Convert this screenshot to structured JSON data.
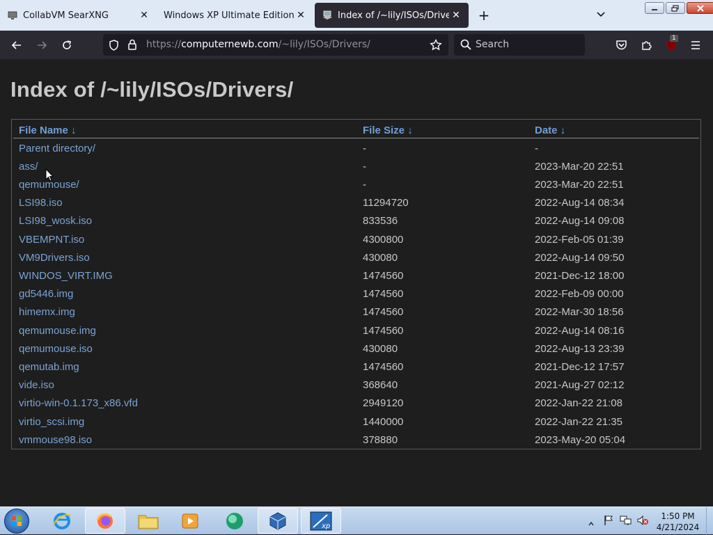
{
  "browser": {
    "tabs": [
      {
        "title": "CollabVM SearXNG",
        "active": false
      },
      {
        "title": "Windows XP Ultimate Edition - Coll",
        "active": false
      },
      {
        "title": "Index of /~lily/ISOs/Drivers/",
        "active": true
      }
    ],
    "url_prefix": "https://",
    "url_host": "computernewb.com",
    "url_path": "/~lily/ISOs/Drivers/",
    "search_placeholder": "Search",
    "extension_badge": "1"
  },
  "page": {
    "title": "Index of /~lily/ISOs/Drivers/",
    "columns": {
      "name": "File Name  ↓",
      "size": "File Size  ↓",
      "date": "Date  ↓"
    },
    "rows": [
      {
        "name": "Parent directory/",
        "size": "-",
        "date": "-"
      },
      {
        "name": "ass/",
        "size": "-",
        "date": "2023-Mar-20 22:51"
      },
      {
        "name": "qemumouse/",
        "size": "-",
        "date": "2023-Mar-20 22:51"
      },
      {
        "name": "LSI98.iso",
        "size": "11294720",
        "date": "2022-Aug-14 08:34"
      },
      {
        "name": "LSI98_wosk.iso",
        "size": "833536",
        "date": "2022-Aug-14 09:08"
      },
      {
        "name": "VBEMPNT.iso",
        "size": "4300800",
        "date": "2022-Feb-05 01:39"
      },
      {
        "name": "VM9Drivers.iso",
        "size": "430080",
        "date": "2022-Aug-14 09:50"
      },
      {
        "name": "WINDOS_VIRT.IMG",
        "size": "1474560",
        "date": "2021-Dec-12 18:00"
      },
      {
        "name": "gd5446.img",
        "size": "1474560",
        "date": "2022-Feb-09 00:00"
      },
      {
        "name": "himemx.img",
        "size": "1474560",
        "date": "2022-Mar-30 18:56"
      },
      {
        "name": "qemumouse.img",
        "size": "1474560",
        "date": "2022-Aug-14 08:16"
      },
      {
        "name": "qemumouse.iso",
        "size": "430080",
        "date": "2022-Aug-13 23:39"
      },
      {
        "name": "qemutab.img",
        "size": "1474560",
        "date": "2021-Dec-12 17:57"
      },
      {
        "name": "vide.iso",
        "size": "368640",
        "date": "2021-Aug-27 02:12"
      },
      {
        "name": "virtio-win-0.1.173_x86.vfd",
        "size": "2949120",
        "date": "2022-Jan-22 21:08"
      },
      {
        "name": "virtio_scsi.img",
        "size": "1440000",
        "date": "2022-Jan-22 21:35"
      },
      {
        "name": "vmmouse98.iso",
        "size": "378880",
        "date": "2023-May-20 05:04"
      }
    ]
  },
  "taskbar": {
    "items": [
      "internet-explorer",
      "firefox",
      "file-explorer",
      "media-player",
      "app-green",
      "virtualbox",
      "xp-app"
    ],
    "time": "1:50 PM",
    "date": "4/21/2024"
  },
  "colors": {
    "link": "#7aa3d6",
    "header": "#6f9fd8",
    "page_bg": "#1e1e1e",
    "chrome_bg": "#2b2a33"
  }
}
